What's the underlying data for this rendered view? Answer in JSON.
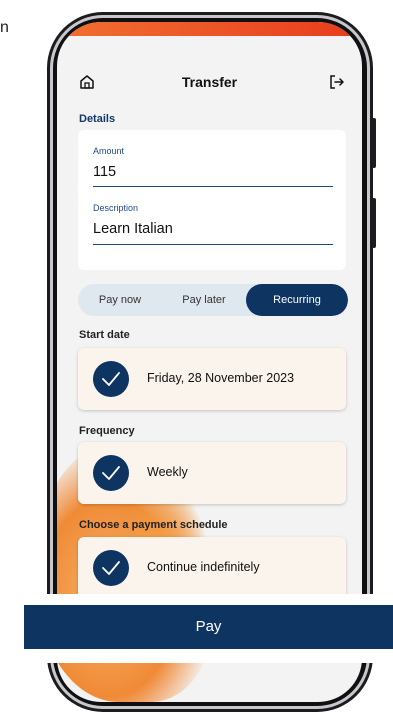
{
  "edge_text": "n",
  "header": {
    "title": "Transfer"
  },
  "details": {
    "section_label": "Details",
    "amount": {
      "label": "Amount",
      "value": "115"
    },
    "description": {
      "label": "Description",
      "value": "Learn Italian"
    }
  },
  "payment_type": {
    "options": [
      "Pay now",
      "Pay later",
      "Recurring"
    ],
    "selected": "Recurring"
  },
  "start_date": {
    "label": "Start date",
    "value": "Friday, 28 November 2023"
  },
  "frequency": {
    "label": "Frequency",
    "value": "Weekly"
  },
  "schedule": {
    "label": "Choose a payment schedule",
    "value": "Continue indefinitely"
  },
  "pay_button": {
    "label": "Pay"
  },
  "colors": {
    "primary": "#0e3462",
    "card": "#faf4ec",
    "accent_orange": "#f08a36"
  }
}
